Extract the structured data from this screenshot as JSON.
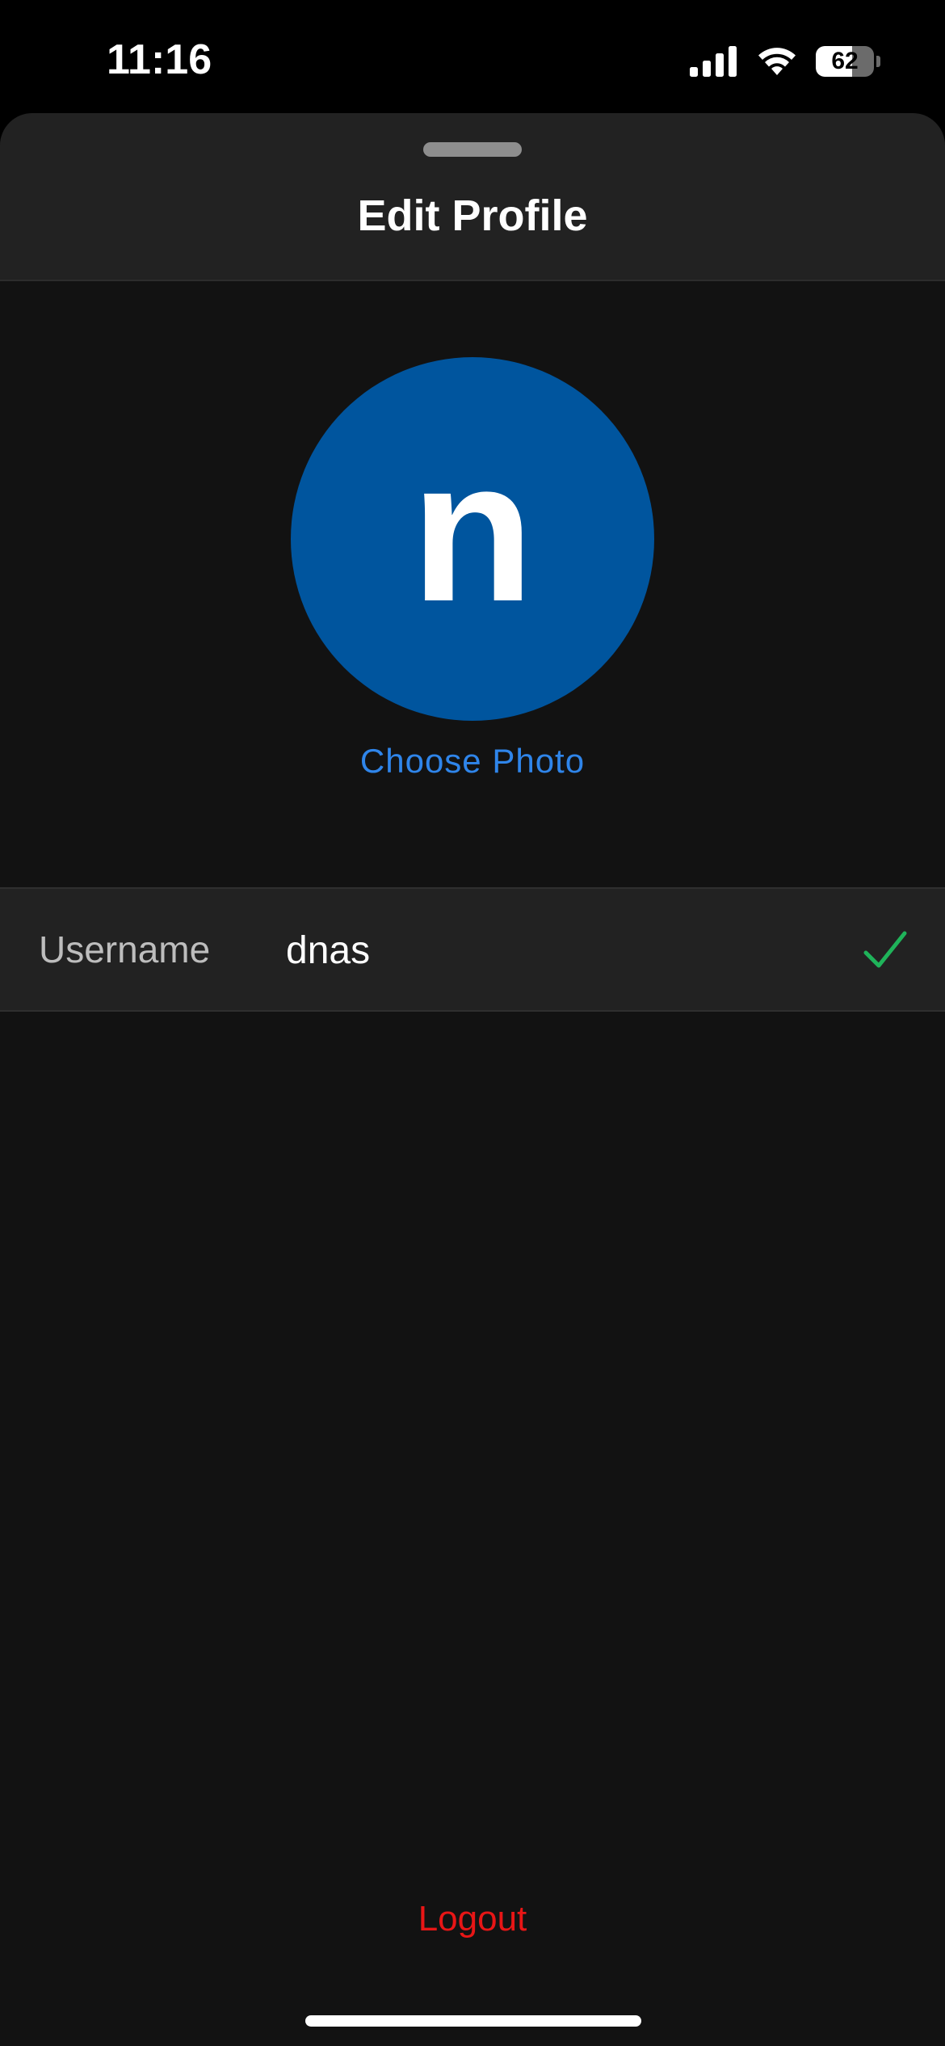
{
  "status_bar": {
    "time": "11:16",
    "battery_level": "62",
    "battery_fraction": 0.62,
    "icons": [
      "signal-icon",
      "wifi-icon",
      "battery-icon"
    ]
  },
  "sheet": {
    "title": "Edit Profile"
  },
  "profile": {
    "avatar_initial": "n",
    "avatar_color": "#00559e",
    "choose_photo_label": "Choose Photo"
  },
  "username": {
    "label": "Username",
    "value": "dnas",
    "status_icon": "check-icon",
    "status_color": "#1fb35a"
  },
  "actions": {
    "logout_label": "Logout",
    "logout_color": "#e81616"
  },
  "colors": {
    "background": "#121212",
    "header": "#222222",
    "accent": "#2f85ea"
  }
}
